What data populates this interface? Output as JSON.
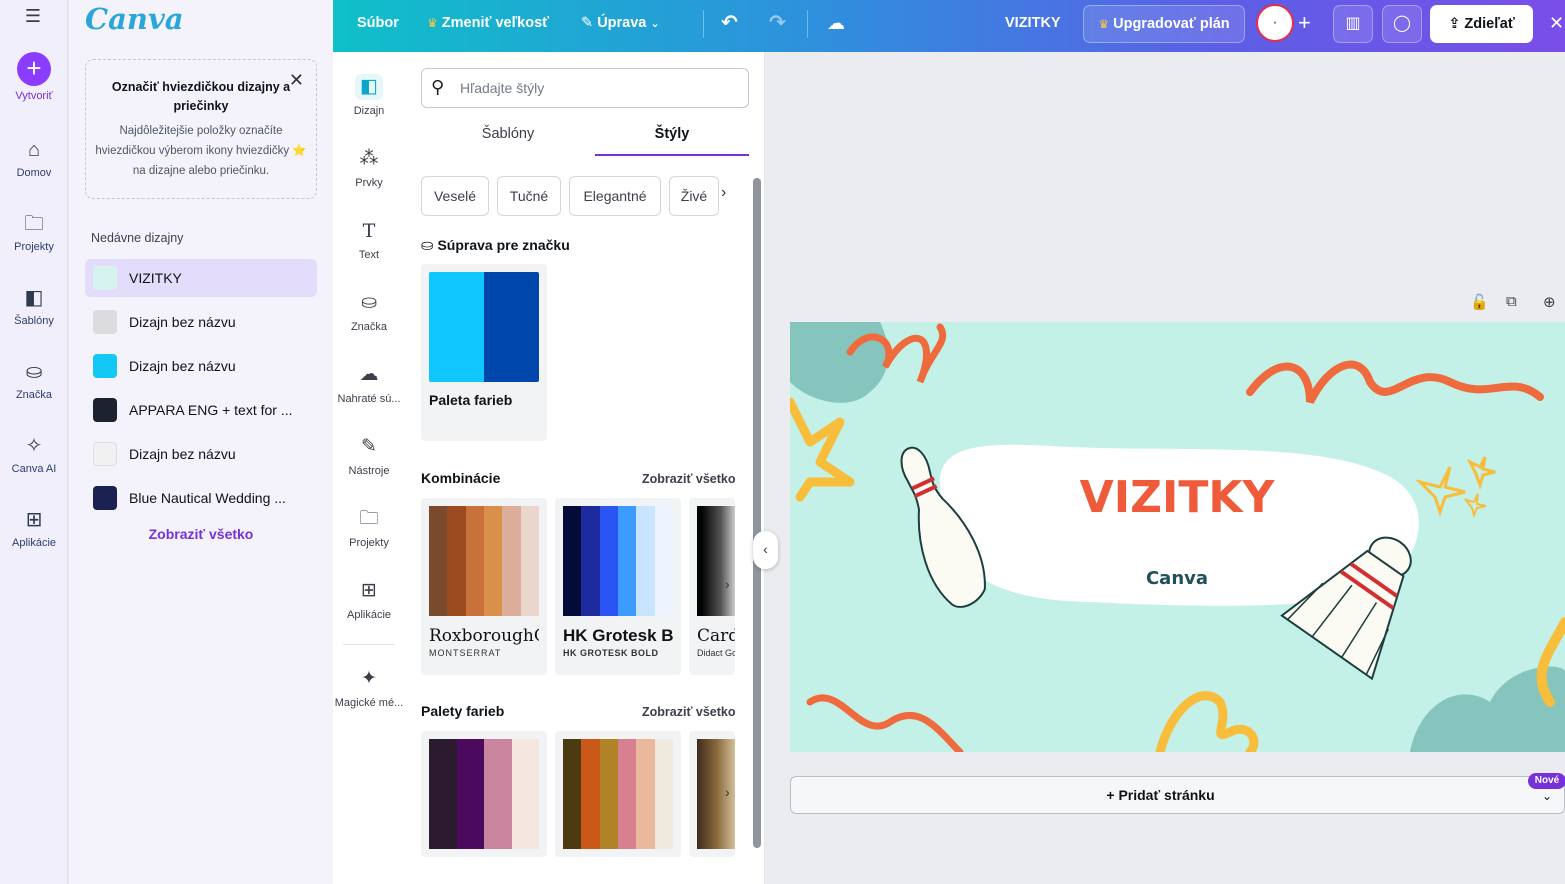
{
  "rail": {
    "items": [
      {
        "label": "Vytvoriť",
        "icon": "plus-icon"
      },
      {
        "label": "Domov",
        "icon": "home-icon"
      },
      {
        "label": "Projekty",
        "icon": "folder-icon"
      },
      {
        "label": "Šablóny",
        "icon": "templates-icon"
      },
      {
        "label": "Značka",
        "icon": "brand-icon"
      },
      {
        "label": "Canva AI",
        "icon": "sparkle-icon"
      },
      {
        "label": "Aplikácie",
        "icon": "apps-icon"
      }
    ]
  },
  "side": {
    "logo": "Canva",
    "star_box": {
      "title": "Označiť hviezdičkou dizajny a priečinky",
      "desc": "Najdôležitejšie položky označíte hviezdičkou výberom ikony hviezdičky ⭐ na dizajne alebo priečinku."
    },
    "recent_title": "Nedávne dizajny",
    "recent": [
      {
        "name": "VIZITKY",
        "thumb": "#d7f3ee"
      },
      {
        "name": "Dizajn bez názvu",
        "thumb": "#dcdcdf"
      },
      {
        "name": "Dizajn bez názvu",
        "thumb": "#14c8f5"
      },
      {
        "name": "APPARA ENG + text for ...",
        "thumb": "#1c2230"
      },
      {
        "name": "Dizajn bez názvu",
        "thumb": "#f1f1f1"
      },
      {
        "name": "Blue Nautical Wedding ...",
        "thumb": "#1b2150"
      }
    ],
    "see_all": "Zobraziť všetko"
  },
  "topbar": {
    "file": "Súbor",
    "resize": "Zmeniť veľkosť",
    "edit": "Úprava",
    "title": "VIZITKY",
    "upgrade": "Upgradovať plán",
    "share": "Zdieľať"
  },
  "tools": [
    {
      "label": "Dizajn",
      "icon": "design-icon"
    },
    {
      "label": "Prvky",
      "icon": "elements-icon"
    },
    {
      "label": "Text",
      "icon": "text-icon"
    },
    {
      "label": "Značka",
      "icon": "brand-icon"
    },
    {
      "label": "Nahraté sú...",
      "icon": "upload-icon"
    },
    {
      "label": "Nástroje",
      "icon": "tools-icon"
    },
    {
      "label": "Projekty",
      "icon": "folder-icon"
    },
    {
      "label": "Aplikácie",
      "icon": "apps-icon"
    },
    {
      "label": "Magické mé...",
      "icon": "magic-media-icon"
    }
  ],
  "panel": {
    "search_placeholder": "Hľadajte štýly",
    "tabs": [
      "Šablóny",
      "Štýly"
    ],
    "chips": [
      "Veselé",
      "Tučné",
      "Elegantné",
      "Živé"
    ],
    "brand_kit_title": "Súprava pre značku",
    "palette_name": "Paleta farieb",
    "palette_colors": [
      "#0fc6ff",
      "#0047ab"
    ],
    "combos_title": "Kombinácie",
    "palettes_title": "Palety farieb",
    "show_all": "Zobraziť všetko",
    "combos": [
      {
        "colors": [
          "#7a4a2d",
          "#9c4a1f",
          "#c8713b",
          "#d9904b",
          "#dcae9a",
          "#ebd5cd"
        ],
        "font_a": "RoxboroughCF",
        "font_b": "MONTSERRAT"
      },
      {
        "colors": [
          "#040b38",
          "#1c2a9e",
          "#2b54f4",
          "#3d9aff",
          "#c8e4ff",
          "#eef4ff"
        ],
        "font_a": "HK Grotesk Bold",
        "font_b": "HK GROTESK BOLD"
      },
      {
        "colors": [
          "#000000",
          "#444444",
          "#cfcfcf"
        ],
        "font_a": "Cardo",
        "font_b": "Didact Gothic"
      }
    ],
    "palettes": [
      [
        "#2c1a2e",
        "#4b0a5e",
        "#c9869e",
        "#f5e6df"
      ],
      [
        "#4c3a10",
        "#c9581a",
        "#b08426",
        "#d7808f",
        "#e9b89d",
        "#efe9de"
      ],
      [
        "#3e2c1c",
        "#8b6a3c",
        "#d9c9a5"
      ]
    ]
  },
  "canvas": {
    "title": "VIZITKY",
    "subtitle": "Canva",
    "add_page": "+ Pridať stránku",
    "new_badge": "Nové"
  },
  "colors": {
    "accent": "#7731d8",
    "page_bg": "#c3f1e8",
    "title": "#ef5a3a",
    "subtitle": "#21505a"
  }
}
